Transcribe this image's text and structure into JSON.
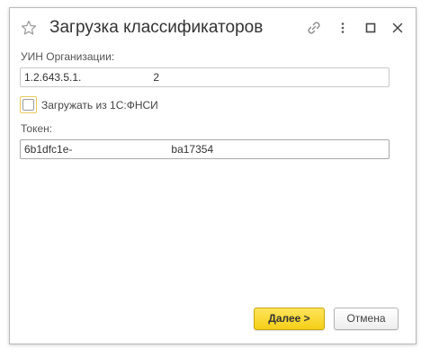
{
  "window": {
    "title": "Загрузка классификаторов"
  },
  "titlebar_icons": [
    "star-icon",
    "link-icon",
    "more-vertical-icon",
    "maximize-icon",
    "close-icon"
  ],
  "form": {
    "uin_label": "УИН Организации:",
    "uin_value": "1.2.643.5.1.                        2",
    "fnsi_checkbox_label": "Загружать из 1С:ФНСИ",
    "fnsi_checked": false,
    "token_label": "Токен:",
    "token_value": "6b1dfc1e-                                 ba17354"
  },
  "buttons": {
    "next_label": "Далее >",
    "cancel_label": "Отмена"
  },
  "colors": {
    "accent_button": "#f5cf18",
    "checkbox_focus": "#e8c95d",
    "title_text": "#333333"
  }
}
